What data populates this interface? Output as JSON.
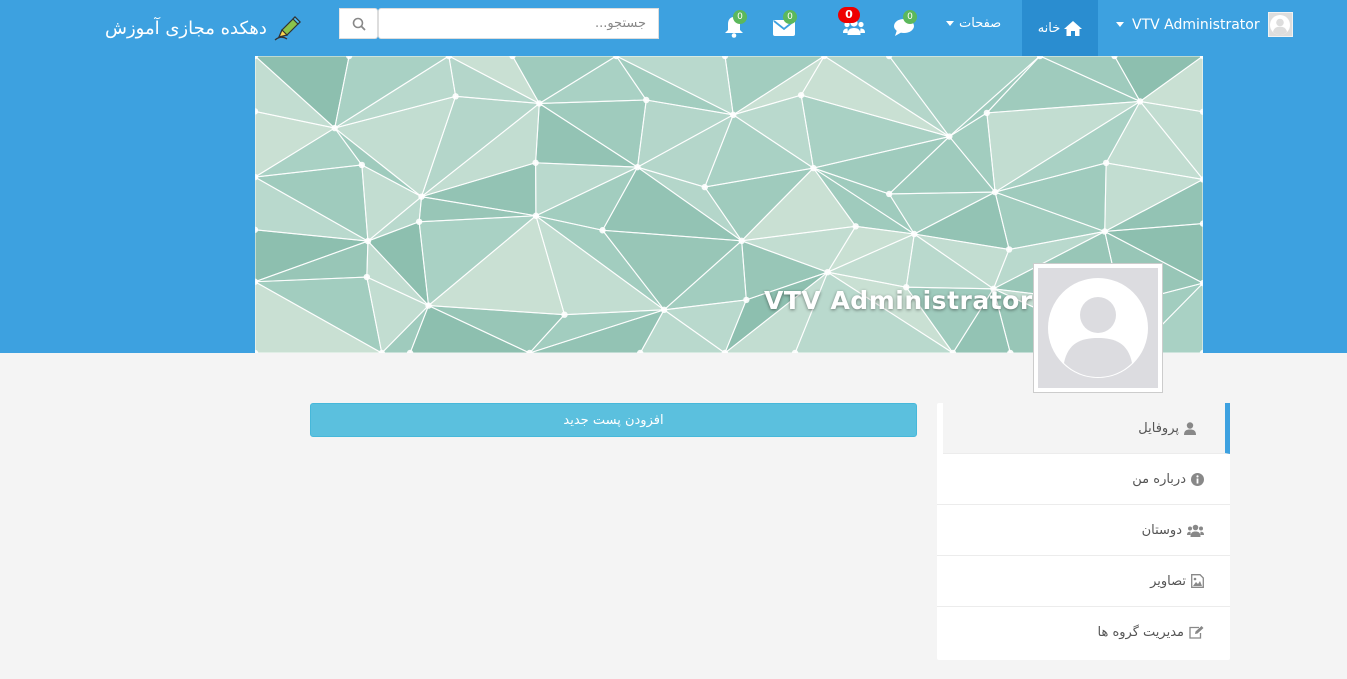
{
  "brand": {
    "title": "دهکده مجازی آموزش"
  },
  "search": {
    "placeholder": "جستجو..."
  },
  "nav": {
    "notifications": {
      "count": "0"
    },
    "messages": {
      "count": "0"
    },
    "friend_requests": {
      "count": "0"
    },
    "chat": {
      "count": "0"
    },
    "pages_label": "صفحات",
    "home_label": "خانه",
    "user_name": "VTV Administrator"
  },
  "profile": {
    "name": "VTV Administrator"
  },
  "sidebar": {
    "items": [
      {
        "label": "پروفایل",
        "icon": "user-icon"
      },
      {
        "label": "درباره من",
        "icon": "info-icon"
      },
      {
        "label": "دوستان",
        "icon": "users-icon"
      },
      {
        "label": "تصاویر",
        "icon": "image-icon"
      },
      {
        "label": "مدیریت گروه ها",
        "icon": "edit-icon"
      }
    ]
  },
  "main": {
    "add_post_label": "افزودن پست جدید"
  },
  "colors": {
    "navbar": "#3da1e0",
    "home_tab": "#2a8dd0",
    "add_post": "#5bc0de",
    "badge": "#5cb85c",
    "badge_alert": "#ee0000"
  }
}
